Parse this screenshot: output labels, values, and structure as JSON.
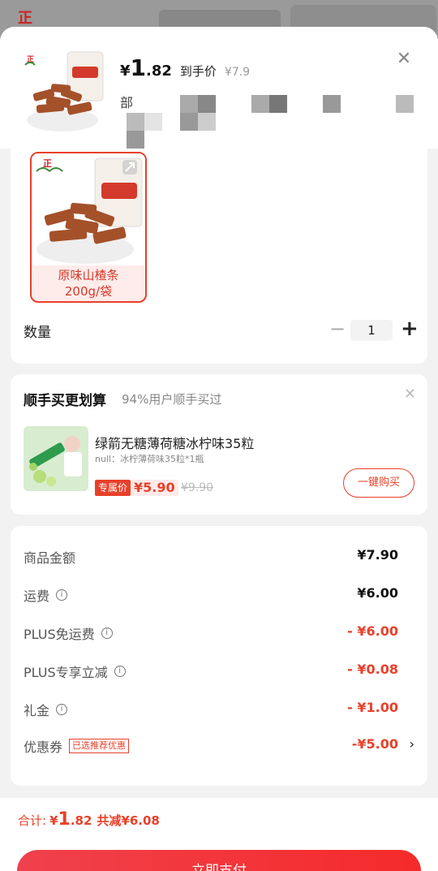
{
  "backdrop": {
    "logo_char": "正"
  },
  "product": {
    "currency": "¥",
    "price_int": "1",
    "price_dec": ".82",
    "price_tag": "到手价",
    "orig_price": "¥7.9",
    "partial_text": "部"
  },
  "variant": {
    "label_line1": "原味山楂条",
    "label_line2": "200g/袋"
  },
  "quantity": {
    "label": "数量",
    "value": "1",
    "minus": "−",
    "plus": "+"
  },
  "addon": {
    "title": "顺手买更划算",
    "subtitle": "94%用户顺手买过",
    "item_name": "绿箭无糖薄荷糖冰柠味35粒",
    "item_spec": "null：冰柠薄荷味35粒*1瓶",
    "exclusive_tag": "专属价",
    "price": "¥5.90",
    "orig_price": "¥9.90",
    "buy_label": "一键购买"
  },
  "summary": {
    "rows": [
      {
        "label": "商品金额",
        "value": "¥7.90",
        "info": false,
        "red": false
      },
      {
        "label": "运费",
        "value": "¥6.00",
        "info": true,
        "red": false
      },
      {
        "label": "PLUS免运费",
        "value": "- ¥6.00",
        "info": true,
        "red": true
      },
      {
        "label": "PLUS专享立减",
        "value": "- ¥0.08",
        "info": true,
        "red": true
      },
      {
        "label": "礼金",
        "value": "- ¥1.00",
        "info": true,
        "red": true
      },
      {
        "label": "优惠券",
        "value": "-¥5.00",
        "info": false,
        "red": true
      }
    ],
    "coupon_tag": "已选推荐优惠",
    "chevron": "›"
  },
  "footer": {
    "total_label": "合计:",
    "currency": "¥",
    "total_int": "1",
    "total_dec": ".82",
    "reduce": "共减¥6.08",
    "pay_label": "立即支付"
  },
  "colors": {
    "accent": "#e8412a",
    "brand_red": "#f52a2a"
  }
}
